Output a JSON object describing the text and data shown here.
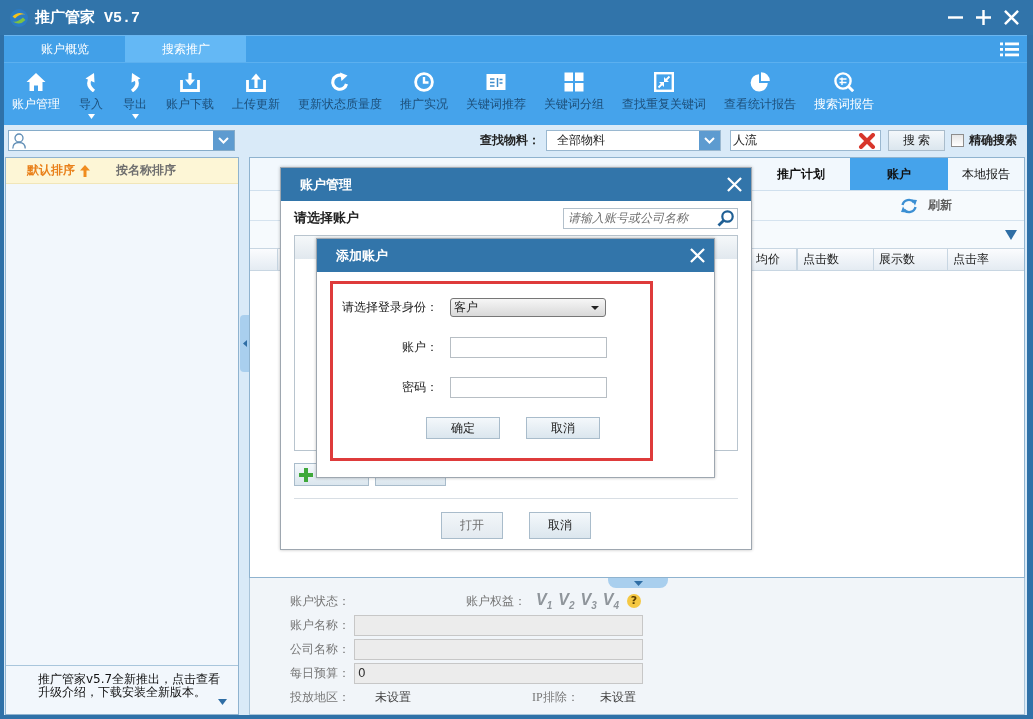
{
  "window": {
    "title": "推广管家 V5.7"
  },
  "main_tabs": [
    {
      "label": "账户概览",
      "selected": false
    },
    {
      "label": "搜索推广",
      "selected": true
    }
  ],
  "toolbar": [
    {
      "label": "账户管理",
      "disabled": false,
      "dropdown": false
    },
    {
      "label": "导入",
      "disabled": true,
      "dropdown": true
    },
    {
      "label": "导出",
      "disabled": true,
      "dropdown": true
    },
    {
      "label": "账户下载",
      "disabled": true,
      "dropdown": false
    },
    {
      "label": "上传更新",
      "disabled": true,
      "dropdown": false
    },
    {
      "label": "更新状态质量度",
      "disabled": true,
      "dropdown": false
    },
    {
      "label": "推广实况",
      "disabled": true,
      "dropdown": false
    },
    {
      "label": "关键词推荐",
      "disabled": true,
      "dropdown": false
    },
    {
      "label": "关键词分组",
      "disabled": true,
      "dropdown": false
    },
    {
      "label": "查找重复关键词",
      "disabled": true,
      "dropdown": false
    },
    {
      "label": "查看统计报告",
      "disabled": true,
      "dropdown": false
    },
    {
      "label": "搜索词报告",
      "disabled": false,
      "dropdown": false
    }
  ],
  "material_search": {
    "label": "查找物料：",
    "scope": "全部物料",
    "query": "人流",
    "button": "搜 索",
    "exact": {
      "label": "精确搜索",
      "checked": false
    }
  },
  "sidebar": {
    "sort_options": [
      {
        "label": "默认排序",
        "selected": true
      },
      {
        "label": "按名称排序",
        "selected": false
      }
    ],
    "notice": "推广管家v5.7全新推出，点击查看升级介绍，下载安装全新版本。"
  },
  "report_panel": {
    "tabs": [
      {
        "label": "推广计划",
        "kind": "tab",
        "selected": false
      },
      {
        "label": "账户",
        "kind": "tab",
        "selected": true
      },
      {
        "label": "本地报告",
        "kind": "button",
        "selected": false
      }
    ],
    "refresh": "刷新",
    "table": {
      "columns": [
        "均价",
        "点击数",
        "展示数",
        "点击率"
      ]
    }
  },
  "account_info": {
    "status_label": "账户状态：",
    "rights_label": "账户权益：",
    "rights_levels": [
      {
        "label": "V$_{1}$",
        "active": false
      },
      {
        "label": "V$_{2}$",
        "active": false
      },
      {
        "label": "V$_{3}$",
        "active": false
      },
      {
        "label": "V$_{4}$",
        "active": false
      }
    ],
    "help": "?",
    "fields": [
      {
        "label": "账户名称："
      },
      {
        "label": "公司名称："
      },
      {
        "label": "每日预算：",
        "value": "0"
      }
    ],
    "region": {
      "label": "投放地区：",
      "value": "未设置"
    },
    "ip_exclusion": {
      "label": "IP排除：",
      "value": "未设置"
    }
  },
  "account_manager_dialog": {
    "title": "账户管理",
    "prompt": "请选择账户",
    "search_placeholder": "请输入账号或公司名称",
    "buttons": [
      {
        "label": "打开",
        "disabled": true
      },
      {
        "label": "取消",
        "disabled": false
      }
    ]
  },
  "add_account_dialog": {
    "title": "添加账户",
    "role": {
      "label": "请选择登录身份：",
      "value": "客户"
    },
    "fields": [
      {
        "label": "账户："
      },
      {
        "label": "密码："
      }
    ],
    "buttons": [
      "确定",
      "取消"
    ]
  }
}
